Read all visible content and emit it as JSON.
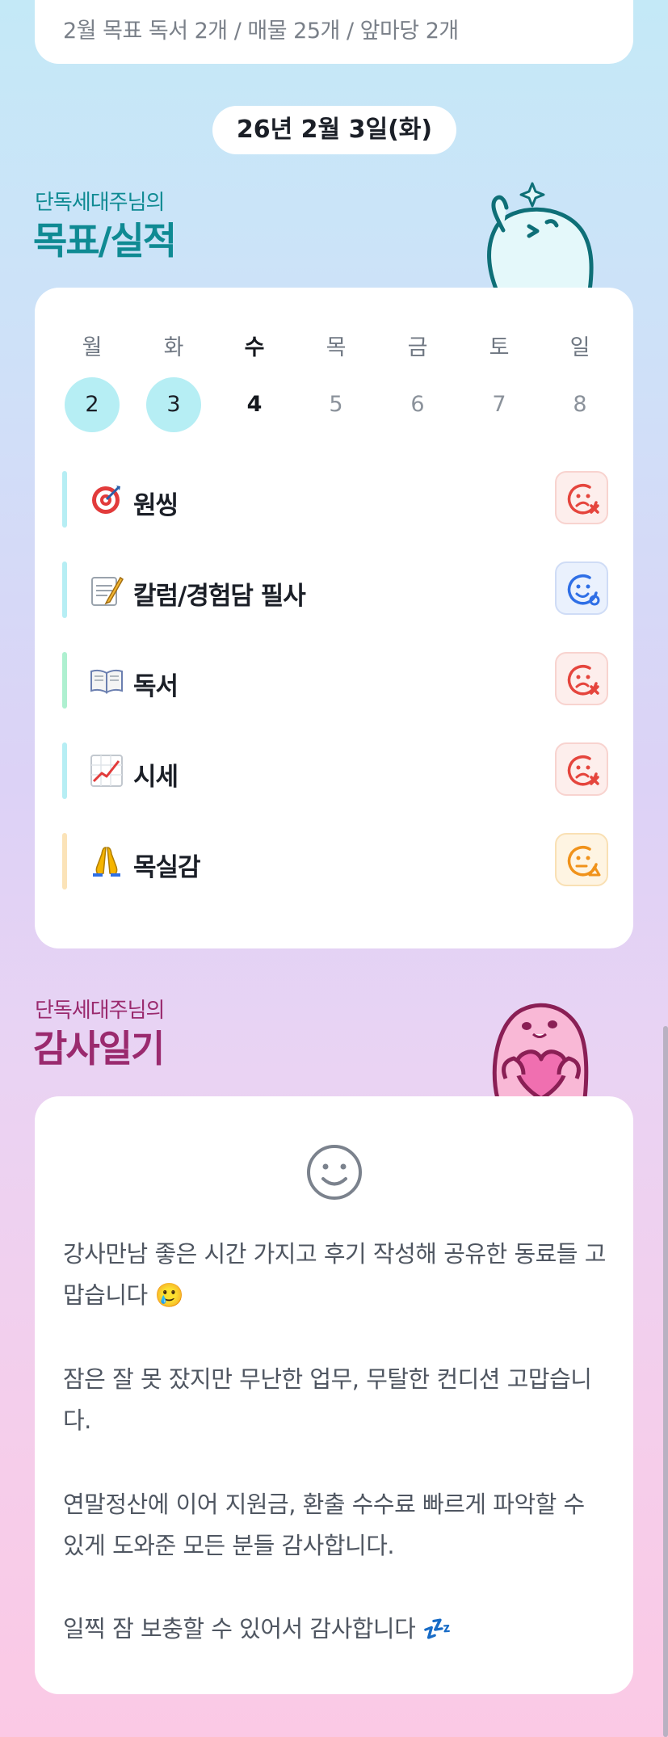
{
  "monthly_goal": {
    "text": "2월 목표  독서 2개 / 매물 25개 / 앞마당 2개"
  },
  "date_label": "26년 2월 3일(화)",
  "goals_section": {
    "subtitle": "단독세대주님의",
    "title": "목표/실적"
  },
  "week": {
    "days": [
      "월",
      "화",
      "수",
      "목",
      "금",
      "토",
      "일"
    ],
    "dates": [
      "2",
      "3",
      "4",
      "5",
      "6",
      "7",
      "8"
    ]
  },
  "goals": [
    {
      "emoji": "target-icon",
      "label": "원씽",
      "status": "failed",
      "bar_color": "#b6eef4"
    },
    {
      "emoji": "memo-icon",
      "label": "칼럼/경험담 필사",
      "status": "in-progress",
      "bar_color": "#b6eef4"
    },
    {
      "emoji": "book-icon",
      "label": "독서",
      "status": "failed",
      "bar_color": "#aef0d0"
    },
    {
      "emoji": "chart-icon",
      "label": "시세",
      "status": "failed",
      "bar_color": "#b6eef4"
    },
    {
      "emoji": "pray-icon",
      "label": "목실감",
      "status": "warning",
      "bar_color": "#fbe3b8"
    }
  ],
  "diary_section": {
    "subtitle": "단독세대주님의",
    "title": "감사일기"
  },
  "diary": {
    "mood_icon": "smile-icon",
    "paragraphs": [
      "강사만남 좋은 시간 가지고 후기 작성해 공유한 동료들 고맙습니다 🥲",
      "잠은 잘 못 잤지만 무난한 업무, 무탈한 컨디션 고맙습니다.",
      "연말정산에 이어 지원금, 환출 수수료 빠르게 파악할 수 있게 도와준 모든 분들 감사합니다.",
      "일찍 잠 보충할 수 있어서 감사합니다 💤"
    ]
  },
  "colors": {
    "teal_title": "#0f8a93",
    "plum_title": "#9a2a6e",
    "selected_day": "#b6eef4",
    "failed": "#e5453d",
    "in_progress": "#2f6fe6",
    "warning": "#f0921a"
  }
}
